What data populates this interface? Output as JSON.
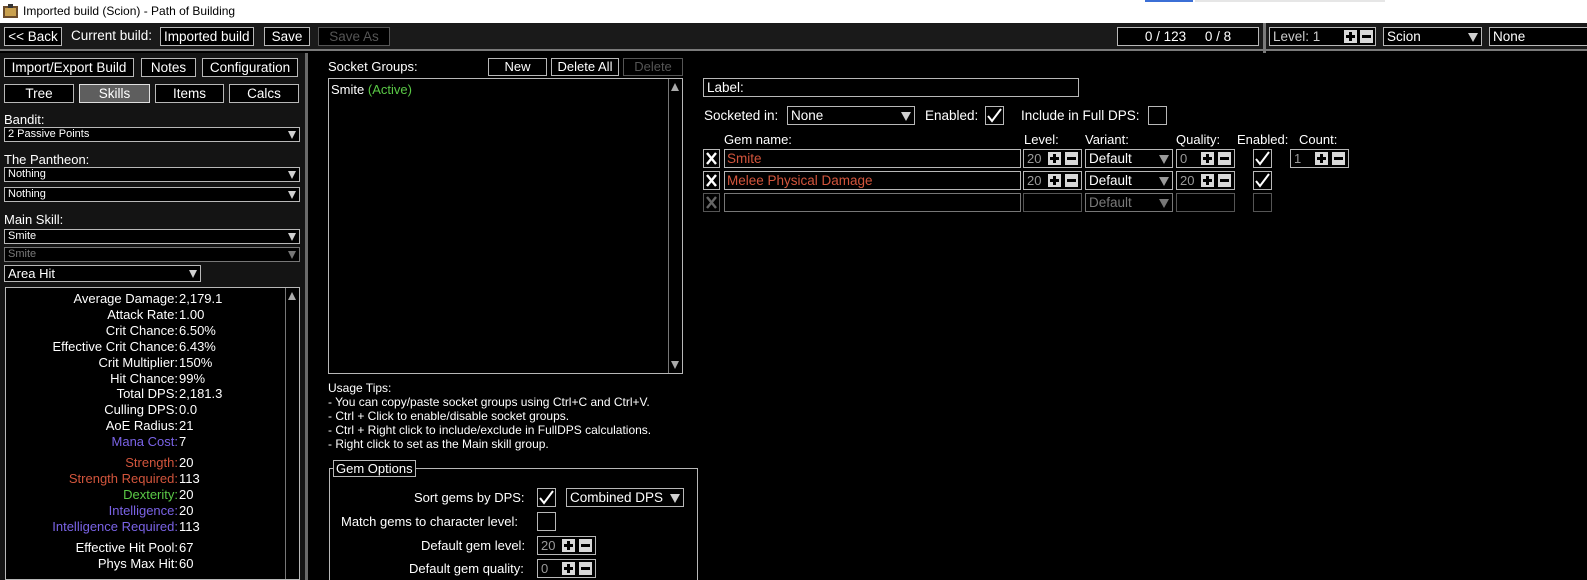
{
  "window": {
    "title": "Imported build (Scion) - Path of Building"
  },
  "topbar": {
    "back_label": "<< Back",
    "current_build_label": "Current build:",
    "build_name": "Imported build",
    "save_label": "Save",
    "save_as_label": "Save As",
    "points_passive": "0  /  123",
    "points_ascend": "0  /  8",
    "level_label": "Level: 1",
    "class_value": "Scion",
    "ascendancy_value": "None"
  },
  "left": {
    "import_export_label": "Import/Export Build",
    "notes_label": "Notes",
    "configuration_label": "Configuration",
    "tabs": [
      {
        "label": "Tree"
      },
      {
        "label": "Skills",
        "selected": true
      },
      {
        "label": "Items"
      },
      {
        "label": "Calcs"
      }
    ],
    "bandit_label": "Bandit:",
    "bandit_value": "2 Passive Points",
    "pantheon_label": "The Pantheon:",
    "pantheon_major": "Nothing",
    "pantheon_minor": "Nothing",
    "main_skill_label": "Main Skill:",
    "main_skill_value": "Smite",
    "main_skill_part": "Smite",
    "skill_mode": "Area Hit",
    "stats": [
      {
        "label": "Average Damage:",
        "value": "2,179.1"
      },
      {
        "label": "Attack Rate:",
        "value": "1.00"
      },
      {
        "label": "Crit Chance:",
        "value": "6.50%"
      },
      {
        "label": "Effective Crit Chance:",
        "value": "6.43%"
      },
      {
        "label": "Crit Multiplier:",
        "value": "150%"
      },
      {
        "label": "Hit Chance:",
        "value": "99%"
      },
      {
        "label": "Total DPS:",
        "value": "2,181.3"
      },
      {
        "label": "Culling DPS:",
        "value": "0.0"
      },
      {
        "label": "AoE Radius:",
        "value": "21"
      },
      {
        "label": "Mana Cost:",
        "value": "7"
      },
      {
        "label": "Strength:",
        "value": "20"
      },
      {
        "label": "Strength Required:",
        "value": "113"
      },
      {
        "label": "Dexterity:",
        "value": "20"
      },
      {
        "label": "Intelligence:",
        "value": "20"
      },
      {
        "label": "Intelligence Required:",
        "value": "113"
      },
      {
        "label": "Effective Hit Pool:",
        "value": "67"
      },
      {
        "label": "Phys Max Hit:",
        "value": "60"
      }
    ]
  },
  "socket_groups": {
    "label": "Socket Groups:",
    "new_label": "New",
    "delete_all_label": "Delete All",
    "delete_label": "Delete",
    "items": [
      {
        "name": "Smite",
        "status": "(Active)"
      }
    ]
  },
  "tips": {
    "title": "Usage Tips:",
    "lines": [
      "- You can copy/paste socket groups using Ctrl+C and Ctrl+V.",
      "- Ctrl + Click to enable/disable socket groups.",
      "- Ctrl + Right click to include/exclude in FullDPS calculations.",
      "- Right click to set as the Main skill group."
    ]
  },
  "gem_options": {
    "title": "Gem Options",
    "sort_label": "Sort gems by DPS:",
    "sort_mode": "Combined DPS",
    "match_level_label": "Match gems to character level:",
    "default_level_label": "Default gem level:",
    "default_level_value": "20",
    "default_quality_label": "Default gem quality:",
    "default_quality_value": "0"
  },
  "group_editor": {
    "label_label": "Label:",
    "socketed_in_label": "Socketed in:",
    "socketed_in_value": "None",
    "enabled_label": "Enabled:",
    "full_dps_label": "Include in Full DPS:",
    "headers": {
      "gem_name": "Gem name:",
      "level": "Level:",
      "variant": "Variant:",
      "quality": "Quality:",
      "enabled": "Enabled:",
      "count": "Count:"
    },
    "gems": [
      {
        "name": "Smite",
        "level": "20",
        "variant": "Default",
        "quality": "0",
        "count": "1"
      },
      {
        "name": "Melee Physical Damage",
        "level": "20",
        "variant": "Default",
        "quality": "20"
      }
    ],
    "empty_variant": "Default"
  },
  "colors": {
    "strength": "#d2553c",
    "dexterity": "#5ac946",
    "intelligence": "#7a63e6",
    "active": "#5ac946"
  }
}
